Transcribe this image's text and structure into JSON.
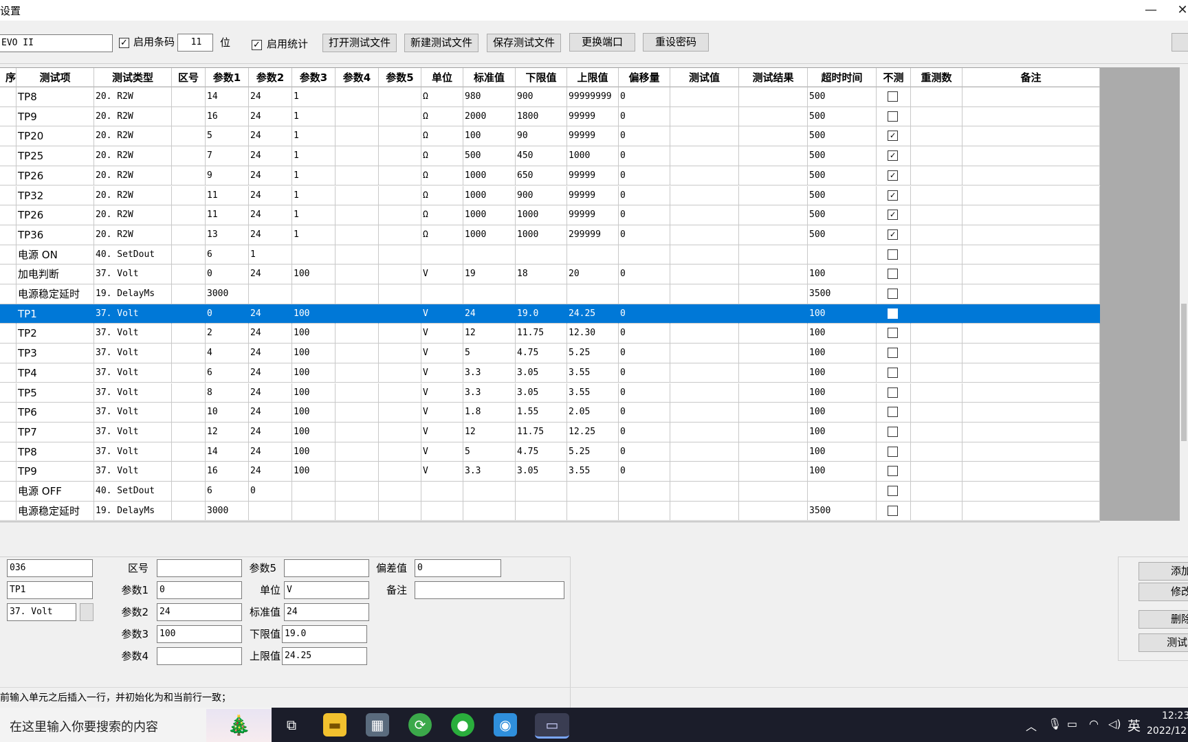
{
  "window": {
    "title": "设置",
    "min_glyph": "—",
    "close_glyph": "✕"
  },
  "toolbar": {
    "product_name": "EVO II",
    "barcode_label": "启用条码",
    "barcode_enabled": true,
    "barcode_digits": "11",
    "digits_unit": "位",
    "stats_label": "启用统计",
    "stats_enabled": true,
    "open_file": "打开测试文件",
    "new_file": "新建测试文件",
    "save_file": "保存测试文件",
    "change_port": "更换端口",
    "reset_password": "重设密码"
  },
  "table": {
    "columns": [
      "序",
      "测试项",
      "测试类型",
      "区号",
      "参数1",
      "参数2",
      "参数3",
      "参数4",
      "参数5",
      "单位",
      "标准值",
      "下限值",
      "上限值",
      "偏移量",
      "测试值",
      "测试结果",
      "超时时间",
      "不测",
      "重测数",
      "备注"
    ],
    "selected_row": 11,
    "rows": [
      {
        "item": "TP8",
        "type": "20. R2W",
        "zone": "",
        "p1": "14",
        "p2": "24",
        "p3": "1",
        "p4": "",
        "p5": "",
        "unit": "Ω",
        "std": "980",
        "low": "900",
        "high": "99999999",
        "offset": "0",
        "value": "",
        "result": "",
        "timeout": "500",
        "skip": false,
        "retest": "",
        "note": ""
      },
      {
        "item": "TP9",
        "type": "20. R2W",
        "zone": "",
        "p1": "16",
        "p2": "24",
        "p3": "1",
        "p4": "",
        "p5": "",
        "unit": "Ω",
        "std": "2000",
        "low": "1800",
        "high": "99999",
        "offset": "0",
        "value": "",
        "result": "",
        "timeout": "500",
        "skip": false,
        "retest": "",
        "note": ""
      },
      {
        "item": "TP20",
        "type": "20. R2W",
        "zone": "",
        "p1": "5",
        "p2": "24",
        "p3": "1",
        "p4": "",
        "p5": "",
        "unit": "Ω",
        "std": "100",
        "low": "90",
        "high": "99999",
        "offset": "0",
        "value": "",
        "result": "",
        "timeout": "500",
        "skip": true,
        "retest": "",
        "note": ""
      },
      {
        "item": "TP25",
        "type": "20. R2W",
        "zone": "",
        "p1": "7",
        "p2": "24",
        "p3": "1",
        "p4": "",
        "p5": "",
        "unit": "Ω",
        "std": "500",
        "low": "450",
        "high": "1000",
        "offset": "0",
        "value": "",
        "result": "",
        "timeout": "500",
        "skip": true,
        "retest": "",
        "note": ""
      },
      {
        "item": "TP26",
        "type": "20. R2W",
        "zone": "",
        "p1": "9",
        "p2": "24",
        "p3": "1",
        "p4": "",
        "p5": "",
        "unit": "Ω",
        "std": "1000",
        "low": "650",
        "high": "99999",
        "offset": "0",
        "value": "",
        "result": "",
        "timeout": "500",
        "skip": true,
        "retest": "",
        "note": ""
      },
      {
        "item": "TP32",
        "type": "20. R2W",
        "zone": "",
        "p1": "11",
        "p2": "24",
        "p3": "1",
        "p4": "",
        "p5": "",
        "unit": "Ω",
        "std": "1000",
        "low": "900",
        "high": "99999",
        "offset": "0",
        "value": "",
        "result": "",
        "timeout": "500",
        "skip": true,
        "retest": "",
        "note": ""
      },
      {
        "item": "TP26",
        "type": "20. R2W",
        "zone": "",
        "p1": "11",
        "p2": "24",
        "p3": "1",
        "p4": "",
        "p5": "",
        "unit": "Ω",
        "std": "1000",
        "low": "1000",
        "high": "99999",
        "offset": "0",
        "value": "",
        "result": "",
        "timeout": "500",
        "skip": true,
        "retest": "",
        "note": ""
      },
      {
        "item": "TP36",
        "type": "20. R2W",
        "zone": "",
        "p1": "13",
        "p2": "24",
        "p3": "1",
        "p4": "",
        "p5": "",
        "unit": "Ω",
        "std": "1000",
        "low": "1000",
        "high": "299999",
        "offset": "0",
        "value": "",
        "result": "",
        "timeout": "500",
        "skip": true,
        "retest": "",
        "note": ""
      },
      {
        "item": "电源 ON",
        "type": "40. SetDout",
        "zone": "",
        "p1": "6",
        "p2": "1",
        "p3": "",
        "p4": "",
        "p5": "",
        "unit": "",
        "std": "",
        "low": "",
        "high": "",
        "offset": "",
        "value": "",
        "result": "",
        "timeout": "",
        "skip": false,
        "retest": "",
        "note": ""
      },
      {
        "item": "加电判断",
        "type": "37. Volt",
        "zone": "",
        "p1": "0",
        "p2": "24",
        "p3": "100",
        "p4": "",
        "p5": "",
        "unit": "V",
        "std": "19",
        "low": "18",
        "high": "20",
        "offset": "0",
        "value": "",
        "result": "",
        "timeout": "100",
        "skip": false,
        "retest": "",
        "note": ""
      },
      {
        "item": "电源稳定延时",
        "type": "19. DelayMs",
        "zone": "",
        "p1": "3000",
        "p2": "",
        "p3": "",
        "p4": "",
        "p5": "",
        "unit": "",
        "std": "",
        "low": "",
        "high": "",
        "offset": "",
        "value": "",
        "result": "",
        "timeout": "3500",
        "skip": false,
        "retest": "",
        "note": ""
      },
      {
        "item": "TP1",
        "type": "37. Volt",
        "zone": "",
        "p1": "0",
        "p2": "24",
        "p3": "100",
        "p4": "",
        "p5": "",
        "unit": "V",
        "std": "24",
        "low": "19.0",
        "high": "24.25",
        "offset": "0",
        "value": "",
        "result": "",
        "timeout": "100",
        "skip": false,
        "retest": "",
        "note": ""
      },
      {
        "item": "TP2",
        "type": "37. Volt",
        "zone": "",
        "p1": "2",
        "p2": "24",
        "p3": "100",
        "p4": "",
        "p5": "",
        "unit": "V",
        "std": "12",
        "low": "11.75",
        "high": "12.30",
        "offset": "0",
        "value": "",
        "result": "",
        "timeout": "100",
        "skip": false,
        "retest": "",
        "note": ""
      },
      {
        "item": "TP3",
        "type": "37. Volt",
        "zone": "",
        "p1": "4",
        "p2": "24",
        "p3": "100",
        "p4": "",
        "p5": "",
        "unit": "V",
        "std": "5",
        "low": "4.75",
        "high": "5.25",
        "offset": "0",
        "value": "",
        "result": "",
        "timeout": "100",
        "skip": false,
        "retest": "",
        "note": ""
      },
      {
        "item": "TP4",
        "type": "37. Volt",
        "zone": "",
        "p1": "6",
        "p2": "24",
        "p3": "100",
        "p4": "",
        "p5": "",
        "unit": "V",
        "std": "3.3",
        "low": "3.05",
        "high": "3.55",
        "offset": "0",
        "value": "",
        "result": "",
        "timeout": "100",
        "skip": false,
        "retest": "",
        "note": ""
      },
      {
        "item": "TP5",
        "type": "37. Volt",
        "zone": "",
        "p1": "8",
        "p2": "24",
        "p3": "100",
        "p4": "",
        "p5": "",
        "unit": "V",
        "std": "3.3",
        "low": "3.05",
        "high": "3.55",
        "offset": "0",
        "value": "",
        "result": "",
        "timeout": "100",
        "skip": false,
        "retest": "",
        "note": ""
      },
      {
        "item": "TP6",
        "type": "37. Volt",
        "zone": "",
        "p1": "10",
        "p2": "24",
        "p3": "100",
        "p4": "",
        "p5": "",
        "unit": "V",
        "std": "1.8",
        "low": "1.55",
        "high": "2.05",
        "offset": "0",
        "value": "",
        "result": "",
        "timeout": "100",
        "skip": false,
        "retest": "",
        "note": ""
      },
      {
        "item": "TP7",
        "type": "37. Volt",
        "zone": "",
        "p1": "12",
        "p2": "24",
        "p3": "100",
        "p4": "",
        "p5": "",
        "unit": "V",
        "std": "12",
        "low": "11.75",
        "high": "12.25",
        "offset": "0",
        "value": "",
        "result": "",
        "timeout": "100",
        "skip": false,
        "retest": "",
        "note": ""
      },
      {
        "item": "TP8",
        "type": "37. Volt",
        "zone": "",
        "p1": "14",
        "p2": "24",
        "p3": "100",
        "p4": "",
        "p5": "",
        "unit": "V",
        "std": "5",
        "low": "4.75",
        "high": "5.25",
        "offset": "0",
        "value": "",
        "result": "",
        "timeout": "100",
        "skip": false,
        "retest": "",
        "note": ""
      },
      {
        "item": "TP9",
        "type": "37. Volt",
        "zone": "",
        "p1": "16",
        "p2": "24",
        "p3": "100",
        "p4": "",
        "p5": "",
        "unit": "V",
        "std": "3.3",
        "low": "3.05",
        "high": "3.55",
        "offset": "0",
        "value": "",
        "result": "",
        "timeout": "100",
        "skip": false,
        "retest": "",
        "note": ""
      },
      {
        "item": "电源 OFF",
        "type": "40. SetDout",
        "zone": "",
        "p1": "6",
        "p2": "0",
        "p3": "",
        "p4": "",
        "p5": "",
        "unit": "",
        "std": "",
        "low": "",
        "high": "",
        "offset": "",
        "value": "",
        "result": "",
        "timeout": "",
        "skip": false,
        "retest": "",
        "note": ""
      },
      {
        "item": "电源稳定延时",
        "type": "19. DelayMs",
        "zone": "",
        "p1": "3000",
        "p2": "",
        "p3": "",
        "p4": "",
        "p5": "",
        "unit": "",
        "std": "",
        "low": "",
        "high": "",
        "offset": "",
        "value": "",
        "result": "",
        "timeout": "3500",
        "skip": false,
        "retest": "",
        "note": ""
      }
    ]
  },
  "editor": {
    "index_value": "036",
    "item_value": "TP1",
    "type_value": "37. Volt",
    "zone_label": "区号",
    "zone_value": "",
    "p1_label": "参数1",
    "p1_value": "0",
    "p2_label": "参数2",
    "p2_value": "24",
    "p3_label": "参数3",
    "p3_value": "100",
    "p4_label": "参数4",
    "p4_value": "",
    "p5_label": "参数5",
    "p5_value": "",
    "unit_label": "单位",
    "unit_value": "V",
    "std_label": "标准值",
    "std_value": "24",
    "low_label": "下限值",
    "low_value": "19.0",
    "high_label": "上限值",
    "high_value": "24.25",
    "dev_label": "偏差值",
    "dev_value": "0",
    "note_label": "备注",
    "note_value": "",
    "add_button": "添加",
    "modify_button": "修改",
    "delete_button": "删除",
    "test_button": "测试("
  },
  "status": {
    "text": "前输入单元之后插入一行，并初始化为和当前行一致；"
  },
  "taskbar": {
    "search_placeholder": "在这里输入你要搜索的内容",
    "ime": "英",
    "time": "12:23",
    "date": "2022/12"
  }
}
